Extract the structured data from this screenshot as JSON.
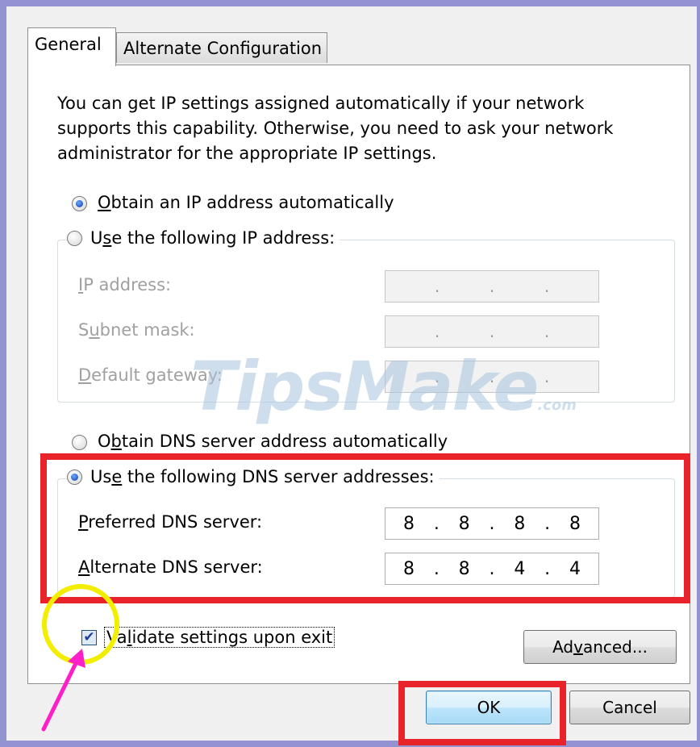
{
  "tabs": [
    {
      "label": "General",
      "active": true
    },
    {
      "label": "Alternate Configuration",
      "active": false
    }
  ],
  "intro_text": "You can get IP settings assigned automatically if your network supports this capability. Otherwise, you need to ask your network administrator for the appropriate IP settings.",
  "ip_options": {
    "auto": {
      "label": "Obtain an IP address automatically",
      "selected": true
    },
    "manual": {
      "label": "Use the following IP address:",
      "selected": false
    }
  },
  "ip_fields": {
    "ip_address": {
      "label": "IP address:",
      "value": [
        ".",
        ".",
        "."
      ]
    },
    "subnet_mask": {
      "label": "Subnet mask:",
      "value": [
        ".",
        ".",
        "."
      ]
    },
    "default_gateway": {
      "label": "Default gateway:",
      "value": [
        ".",
        ".",
        "."
      ]
    }
  },
  "dns_options": {
    "auto": {
      "label": "Obtain DNS server address automatically",
      "selected": false
    },
    "manual": {
      "label": "Use the following DNS server addresses:",
      "selected": true
    }
  },
  "dns_fields": {
    "preferred": {
      "label": "Preferred DNS server:",
      "octets": [
        "8",
        ".",
        "8",
        ".",
        "8",
        ".",
        "8"
      ]
    },
    "alternate": {
      "label": "Alternate DNS server:",
      "octets": [
        "8",
        ".",
        "8",
        ".",
        "4",
        ".",
        "4"
      ]
    }
  },
  "validate_checkbox": {
    "label": "Validate settings upon exit",
    "checked": true
  },
  "buttons": {
    "advanced": "Advanced...",
    "ok": "OK",
    "cancel": "Cancel"
  },
  "watermark": {
    "main": "TipsMake",
    "suffix": ".com"
  },
  "colors": {
    "highlight_red": "#e8232a",
    "highlight_yellow": "#f3ee00",
    "arrow_pink": "#ff1fc8",
    "frame": "#9393d1"
  }
}
